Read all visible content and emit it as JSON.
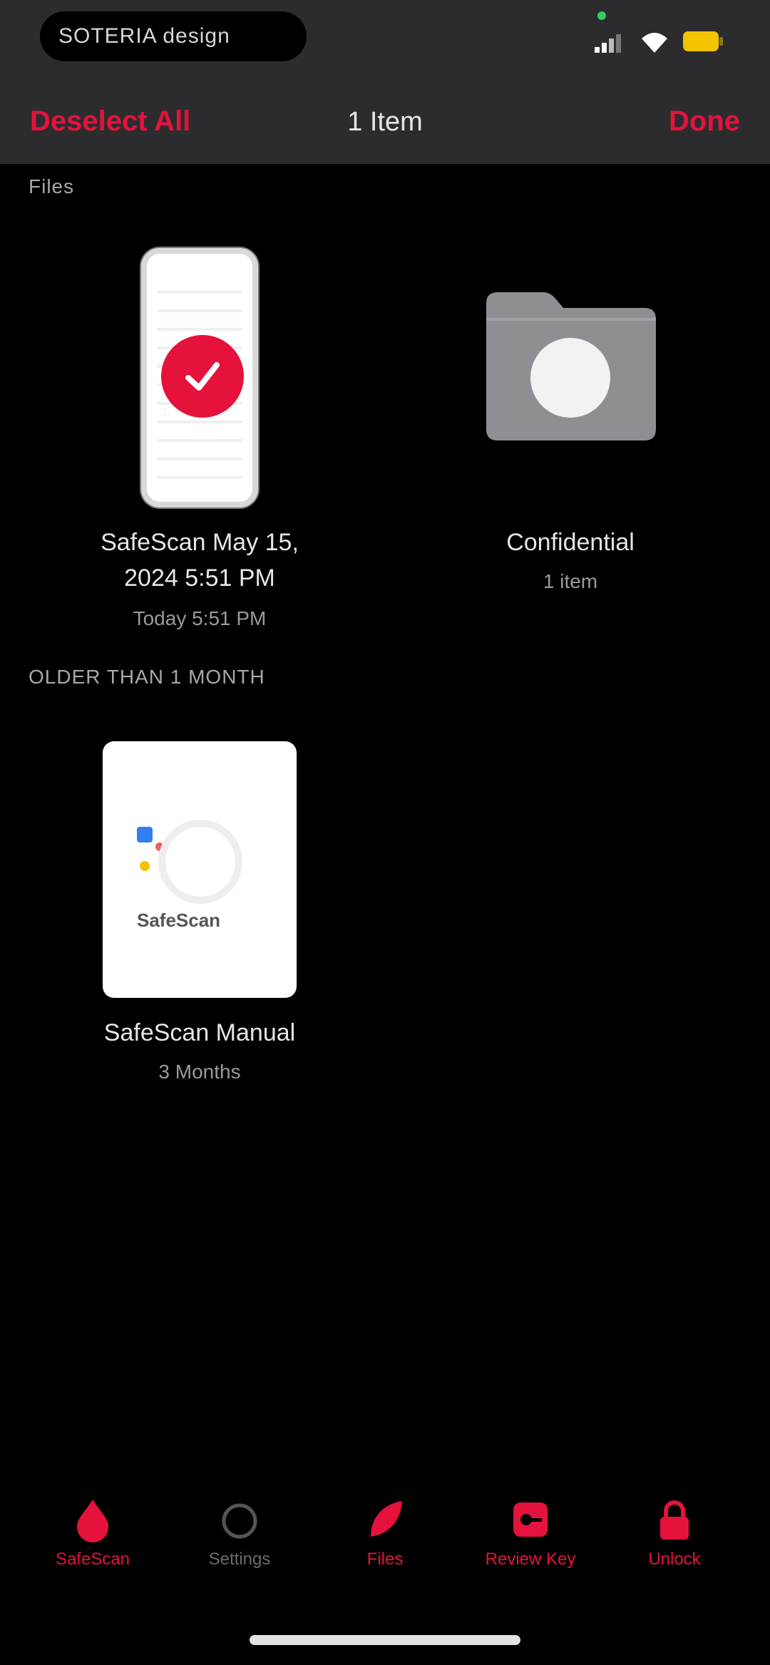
{
  "status_bar": {
    "pill_text": "SOTERIA design",
    "icons": [
      "signal-icon",
      "wifi-icon",
      "battery-icon"
    ]
  },
  "nav": {
    "back_label": "Deselect All",
    "title": "1 Item",
    "done_label": "Done"
  },
  "sections": {
    "recent_label": "Files",
    "older_label": "OLDER THAN 1 MONTH"
  },
  "items": [
    {
      "name_line1": "SafeScan May 15,",
      "name_line2": "2024 5:51 PM",
      "meta": "Today 5:51 PM",
      "icon": "phone-scan-thumbnail",
      "selected": true
    },
    {
      "name_line1": "Confidential",
      "meta": "1 item",
      "icon": "folder-icon",
      "selected": false
    },
    {
      "name_line1": "SafeScan Manual",
      "meta": "3 Months",
      "icon": "document-thumbnail",
      "selected": false
    }
  ],
  "tabbar": {
    "items": [
      {
        "label": "SafeScan",
        "icon": "drop-icon",
        "active": true
      },
      {
        "label": "Settings",
        "icon": "circle-icon",
        "active": false
      },
      {
        "label": "Files",
        "icon": "leaf-icon",
        "active": true
      },
      {
        "label": "Review Key",
        "icon": "key-box-icon",
        "active": true
      },
      {
        "label": "Unlock",
        "icon": "lock-icon",
        "active": true
      }
    ]
  },
  "colors": {
    "accent": "#e5123c",
    "header_bg": "#2c2c2e",
    "background": "#000000",
    "battery": "#f5c400"
  }
}
